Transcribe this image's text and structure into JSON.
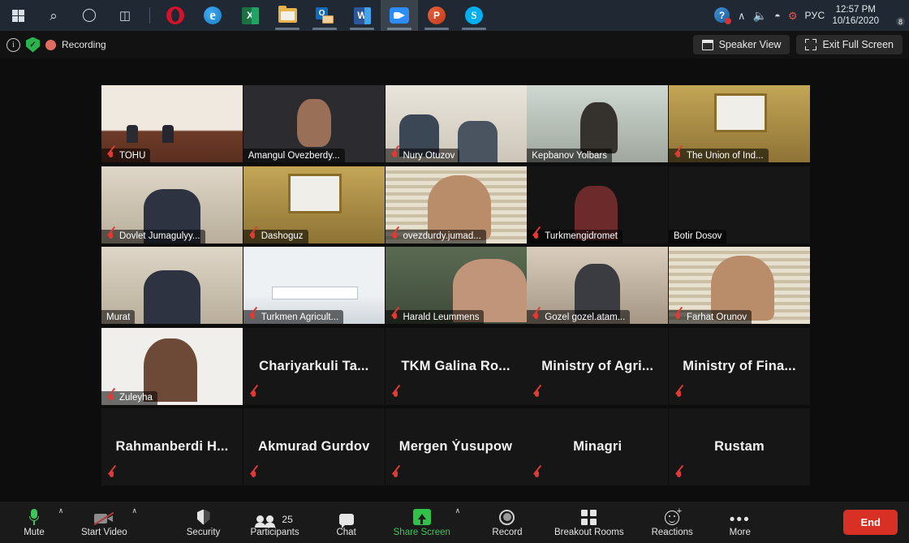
{
  "taskbar": {
    "start_label": "Start",
    "apps": [
      {
        "name": "search-icon",
        "label": "Search"
      },
      {
        "name": "cortana-icon",
        "label": "Cortana"
      },
      {
        "name": "task-view-icon",
        "label": "Task View"
      },
      {
        "name": "opera-icon",
        "label": "Opera"
      },
      {
        "name": "edge-icon",
        "label": "Microsoft Edge"
      },
      {
        "name": "excel-icon",
        "label": "Excel"
      },
      {
        "name": "file-explorer-icon",
        "label": "File Explorer"
      },
      {
        "name": "outlook-icon",
        "label": "Outlook"
      },
      {
        "name": "word-icon",
        "label": "Word"
      },
      {
        "name": "zoom-icon",
        "label": "Zoom"
      },
      {
        "name": "powerpoint-icon",
        "label": "PowerPoint"
      },
      {
        "name": "skype-icon",
        "label": "Skype"
      }
    ],
    "tray": {
      "help_glyph": "?",
      "show_hidden_glyph": "∧",
      "volume_glyph": "🔊",
      "wifi_glyph": "📶",
      "language": "РУС",
      "time": "12:57 PM",
      "date": "10/16/2020",
      "notification_count": "8"
    }
  },
  "meeting_bar": {
    "info_glyph": "i",
    "encryption_glyph": "✓",
    "recording_label": "Recording",
    "speaker_view_label": "Speaker View",
    "exit_full_screen_label": "Exit Full Screen"
  },
  "gallery": {
    "active_speaker_color": "#b9e000",
    "participants": [
      {
        "name": "TOHU",
        "muted": true,
        "video": true,
        "speaking": false,
        "style": "conf",
        "display": "bar"
      },
      {
        "name": "Amangul Ovezberdy...",
        "muted": false,
        "video": true,
        "speaking": true,
        "style": "portrait",
        "display": "bar"
      },
      {
        "name": "Nury Otuzov",
        "muted": true,
        "video": true,
        "speaking": false,
        "style": "office",
        "display": "bar"
      },
      {
        "name": "Kepbanov Yolbars",
        "muted": false,
        "video": true,
        "speaking": false,
        "style": "mask",
        "display": "bar"
      },
      {
        "name": "The Union of Ind...",
        "muted": true,
        "video": true,
        "speaking": false,
        "style": "hall",
        "display": "bar"
      },
      {
        "name": "Dovlet Jumagulyy...",
        "muted": true,
        "video": true,
        "speaking": false,
        "style": "room",
        "display": "bar"
      },
      {
        "name": "Dashoguz",
        "muted": true,
        "video": true,
        "speaking": false,
        "style": "hall",
        "display": "bar"
      },
      {
        "name": "ovezdurdy.jumad...",
        "muted": true,
        "video": true,
        "speaking": false,
        "style": "blinds",
        "display": "bar"
      },
      {
        "name": "Turkmengidromet",
        "muted": true,
        "video": true,
        "speaking": false,
        "style": "dark",
        "display": "bar"
      },
      {
        "name": "Botir Dosov",
        "muted": false,
        "video": false,
        "speaking": false,
        "style": "blank",
        "display": "bar"
      },
      {
        "name": "Murat",
        "muted": false,
        "video": true,
        "speaking": false,
        "style": "room",
        "display": "bar"
      },
      {
        "name": "Turkmen Agricult...",
        "muted": true,
        "video": true,
        "speaking": false,
        "style": "table",
        "display": "bar"
      },
      {
        "name": "Harald Leummens",
        "muted": true,
        "video": true,
        "speaking": false,
        "style": "greenwall",
        "display": "bar"
      },
      {
        "name": "Gozel gozel.atam...",
        "muted": true,
        "video": true,
        "speaking": false,
        "style": "chair",
        "display": "bar"
      },
      {
        "name": "Farhat Orunov",
        "muted": true,
        "video": true,
        "speaking": false,
        "style": "blinds",
        "display": "bar"
      },
      {
        "name": "Zuleyha",
        "muted": true,
        "video": true,
        "speaking": false,
        "style": "selfie",
        "display": "bar"
      },
      {
        "name": "Chariyarkuli  Ta...",
        "muted": true,
        "video": false,
        "speaking": false,
        "style": "blank",
        "display": "name"
      },
      {
        "name": "TKM Galina Ro...",
        "muted": true,
        "video": false,
        "speaking": false,
        "style": "blank",
        "display": "name"
      },
      {
        "name": "Ministry of Agri...",
        "muted": true,
        "video": false,
        "speaking": false,
        "style": "blank",
        "display": "name"
      },
      {
        "name": "Ministry of Fina...",
        "muted": true,
        "video": false,
        "speaking": false,
        "style": "blank",
        "display": "name"
      },
      {
        "name": "Rahmanberdi  H...",
        "muted": true,
        "video": false,
        "speaking": false,
        "style": "blank",
        "display": "name"
      },
      {
        "name": "Akmurad Gurdov",
        "muted": true,
        "video": false,
        "speaking": false,
        "style": "blank",
        "display": "name"
      },
      {
        "name": "Mergen Ýusupow",
        "muted": true,
        "video": false,
        "speaking": false,
        "style": "blank",
        "display": "name"
      },
      {
        "name": "Minagri",
        "muted": true,
        "video": false,
        "speaking": false,
        "style": "blank",
        "display": "name"
      },
      {
        "name": "Rustam",
        "muted": true,
        "video": false,
        "speaking": false,
        "style": "blank",
        "display": "name"
      }
    ]
  },
  "controls": {
    "mute_label": "Mute",
    "start_video_label": "Start Video",
    "security_label": "Security",
    "participants_label": "Participants",
    "participants_count": "25",
    "chat_label": "Chat",
    "share_screen_label": "Share Screen",
    "share_screen_color": "#3ec65a",
    "record_label": "Record",
    "breakout_rooms_label": "Breakout Rooms",
    "reactions_label": "Reactions",
    "more_label": "More",
    "end_label": "End",
    "end_color": "#d93025",
    "chevron_glyph": "∧"
  }
}
